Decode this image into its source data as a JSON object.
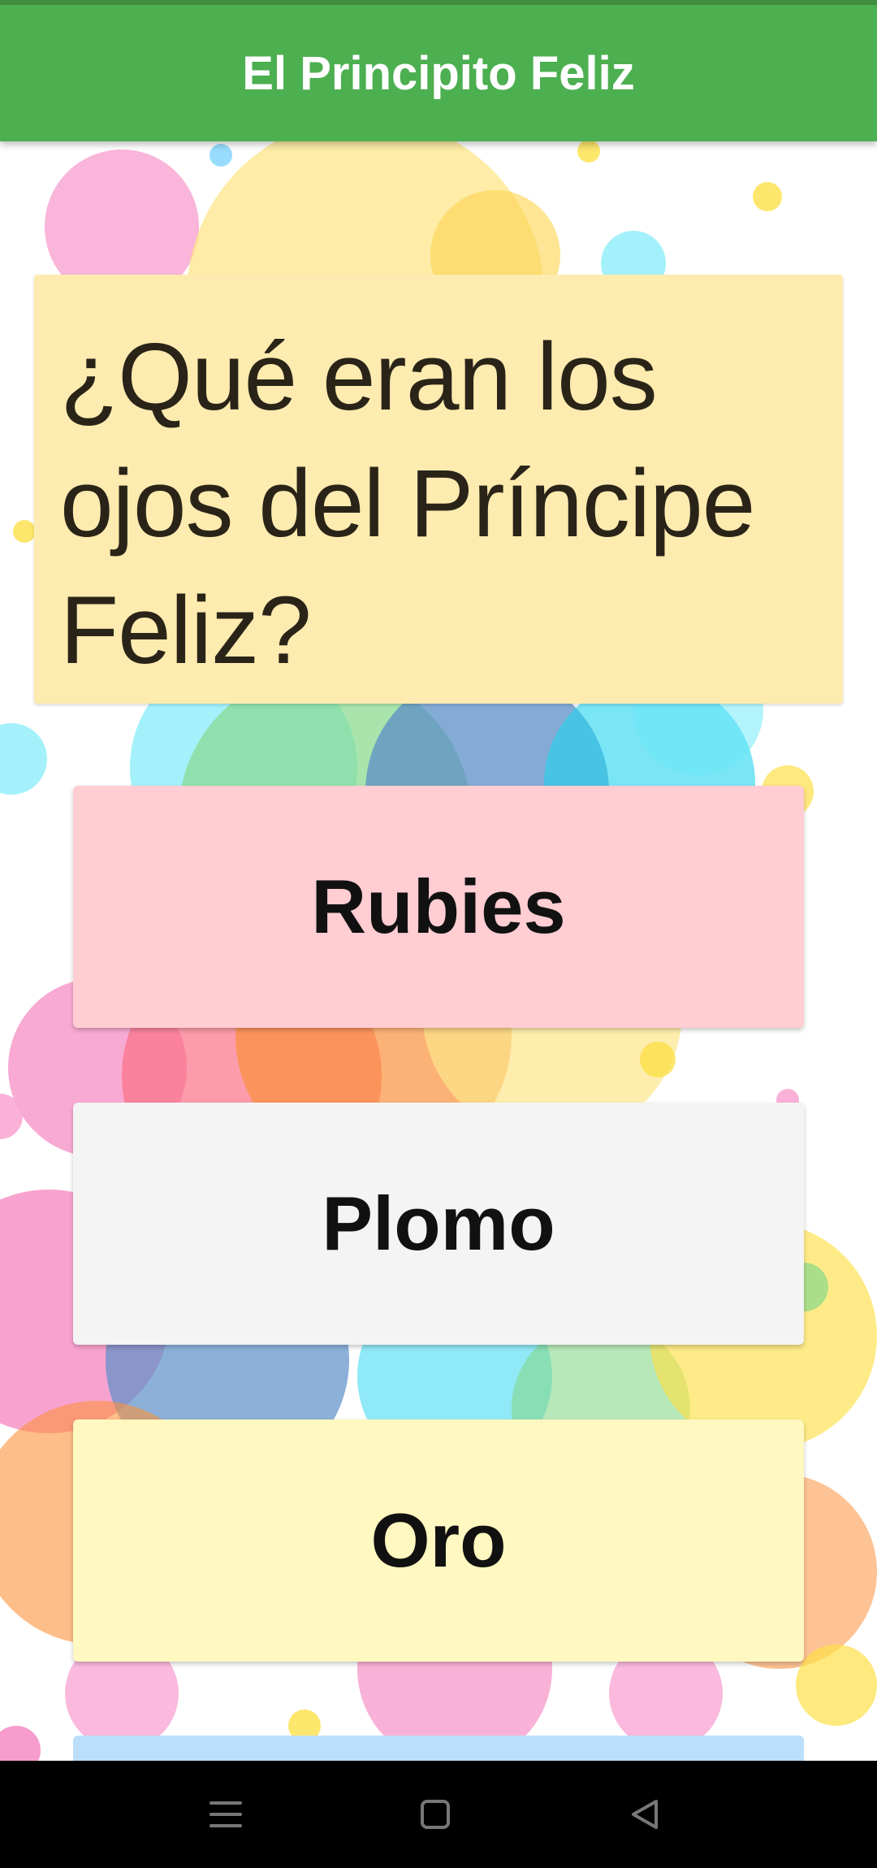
{
  "app": {
    "title": "El Principito Feliz"
  },
  "question": {
    "text": "¿Qué eran los ojos del Príncipe Feliz?"
  },
  "answers": [
    {
      "label": "Rubies",
      "color": "#ffcdd2"
    },
    {
      "label": "Plomo",
      "color": "#f4f4f4"
    },
    {
      "label": "Oro",
      "color": "#fff8c0"
    },
    {
      "label": "",
      "color": "#bbdefb"
    }
  ],
  "colors": {
    "app_bar": "#4caf50",
    "question_card": "#feebb0",
    "nav_bar": "#000000"
  },
  "nav": {
    "menu_icon": "menu-icon",
    "home_icon": "home-square-icon",
    "back_icon": "back-triangle-icon"
  }
}
